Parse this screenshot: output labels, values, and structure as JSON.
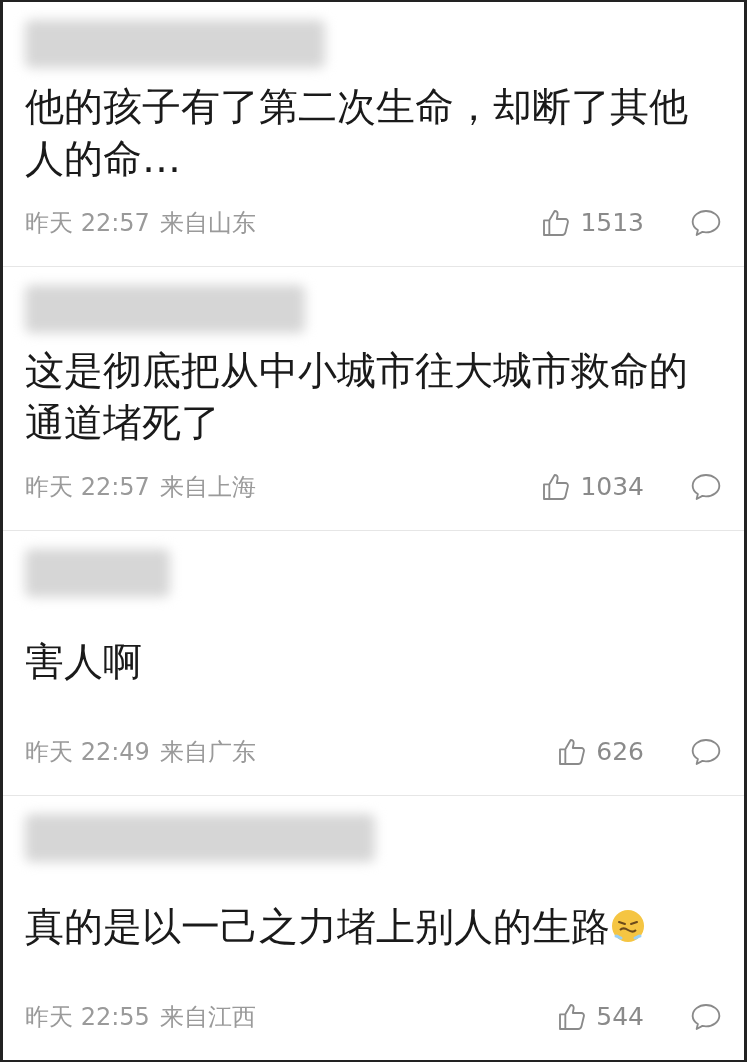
{
  "comments": [
    {
      "text": "他的孩子有了第二次生命，却断了其他人的命…",
      "time": "昨天 22:57",
      "location": "来自山东",
      "likes": "1513",
      "emoji": false
    },
    {
      "text": "这是彻底把从中小城市往大城市救命的通道堵死了",
      "time": "昨天 22:57",
      "location": "来自上海",
      "likes": "1034",
      "emoji": false
    },
    {
      "text": "害人啊",
      "time": "昨天 22:49",
      "location": "来自广东",
      "likes": "626",
      "emoji": false
    },
    {
      "text": "真的是以一己之力堵上别人的生路",
      "time": "昨天 22:55",
      "location": "来自江西",
      "likes": "544",
      "emoji": true
    }
  ]
}
